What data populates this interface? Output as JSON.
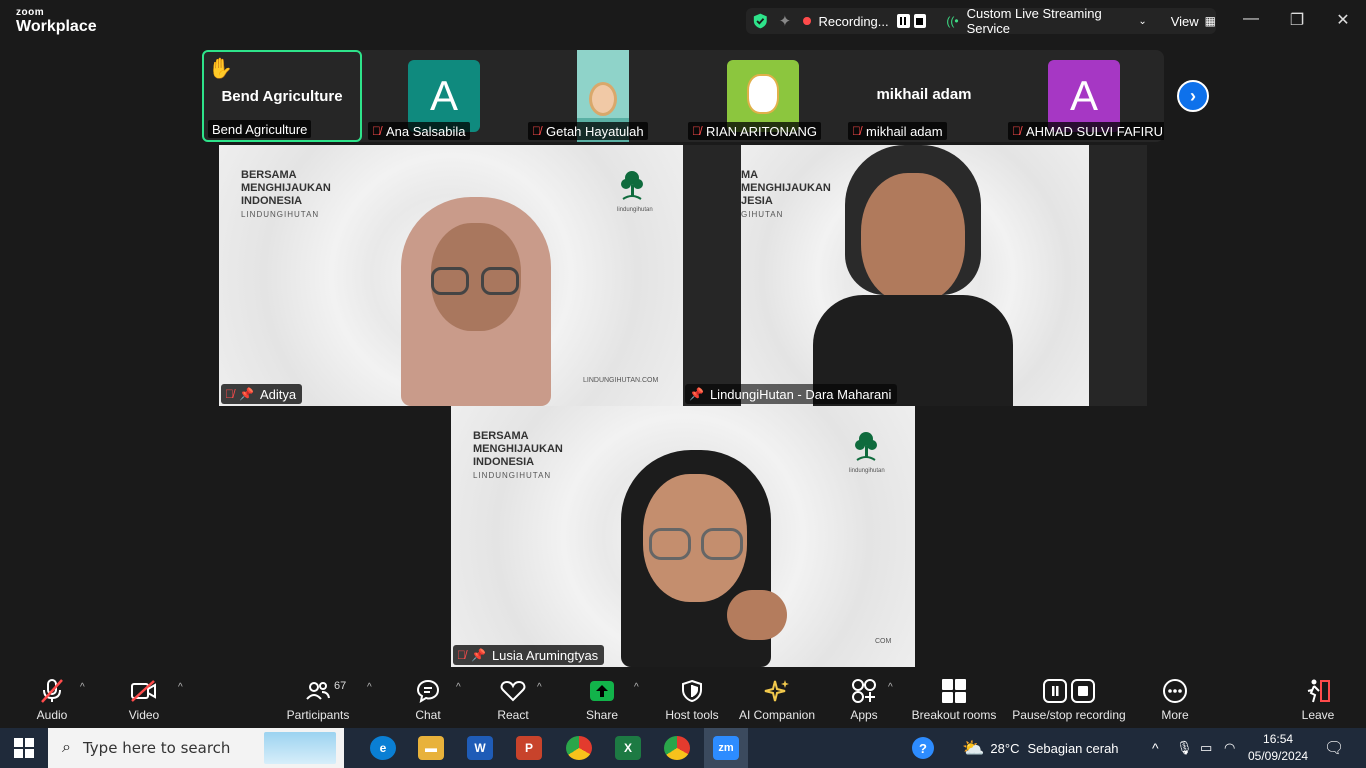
{
  "app": {
    "brand_small": "zoom",
    "brand_large": "Workplace"
  },
  "titlebar": {
    "recording_label": "Recording...",
    "stream_label": "Custom Live Streaming Service",
    "view_label": "View"
  },
  "thumbnails": [
    {
      "name": "Bend Agriculture",
      "display": "Bend Agriculture",
      "raised_hand": true,
      "muted": false
    },
    {
      "name": "Ana Salsabila",
      "initial": "A",
      "color": "#0f8a7e",
      "muted": true
    },
    {
      "name": "Getah Hayatulah",
      "muted": true
    },
    {
      "name": "RIAN ARITONANG",
      "muted": true
    },
    {
      "name": "mikhail adam",
      "display": "mikhail adam",
      "muted": true
    },
    {
      "name": "AHMAD SULVI FAFIRU...",
      "initial": "A",
      "color": "#a637c4",
      "muted": true
    }
  ],
  "slogan": {
    "line1": "BERSAMA",
    "line2": "MENGHIJAUKAN",
    "line3": "INDONESIA",
    "line4": "LINDUNGIHUTAN",
    "partial1": "MA",
    "partial2": "MENGHIJAUKAN",
    "partial3": "JESIA",
    "partial4": "GIHUTAN",
    "brand_small": "lindungihutan",
    "url": "LINDUNGIHUTAN.COM",
    "url_partial": "COM"
  },
  "videos": [
    {
      "name": "Aditya"
    },
    {
      "name": "LindungiHutan - Dara Maharani"
    },
    {
      "name": "Lusia Arumingtyas"
    }
  ],
  "toolbar": {
    "audio": "Audio",
    "video": "Video",
    "participants": "Participants",
    "participants_count": "67",
    "chat": "Chat",
    "react": "React",
    "share": "Share",
    "host_tools": "Host tools",
    "ai_companion": "AI Companion",
    "apps": "Apps",
    "breakout": "Breakout rooms",
    "pause_stop": "Pause/stop recording",
    "more": "More",
    "leave": "Leave"
  },
  "taskbar": {
    "search_placeholder": "Type here to search",
    "weather_temp": "28°C",
    "weather_desc": "Sebagian cerah",
    "time": "16:54",
    "date": "05/09/2024",
    "zoom_badge": "zm"
  },
  "colors": {
    "active_border": "#2ee38a",
    "mute_red": "#ff4b4b",
    "share_green": "#12b34a",
    "next_blue": "#0e71eb"
  }
}
